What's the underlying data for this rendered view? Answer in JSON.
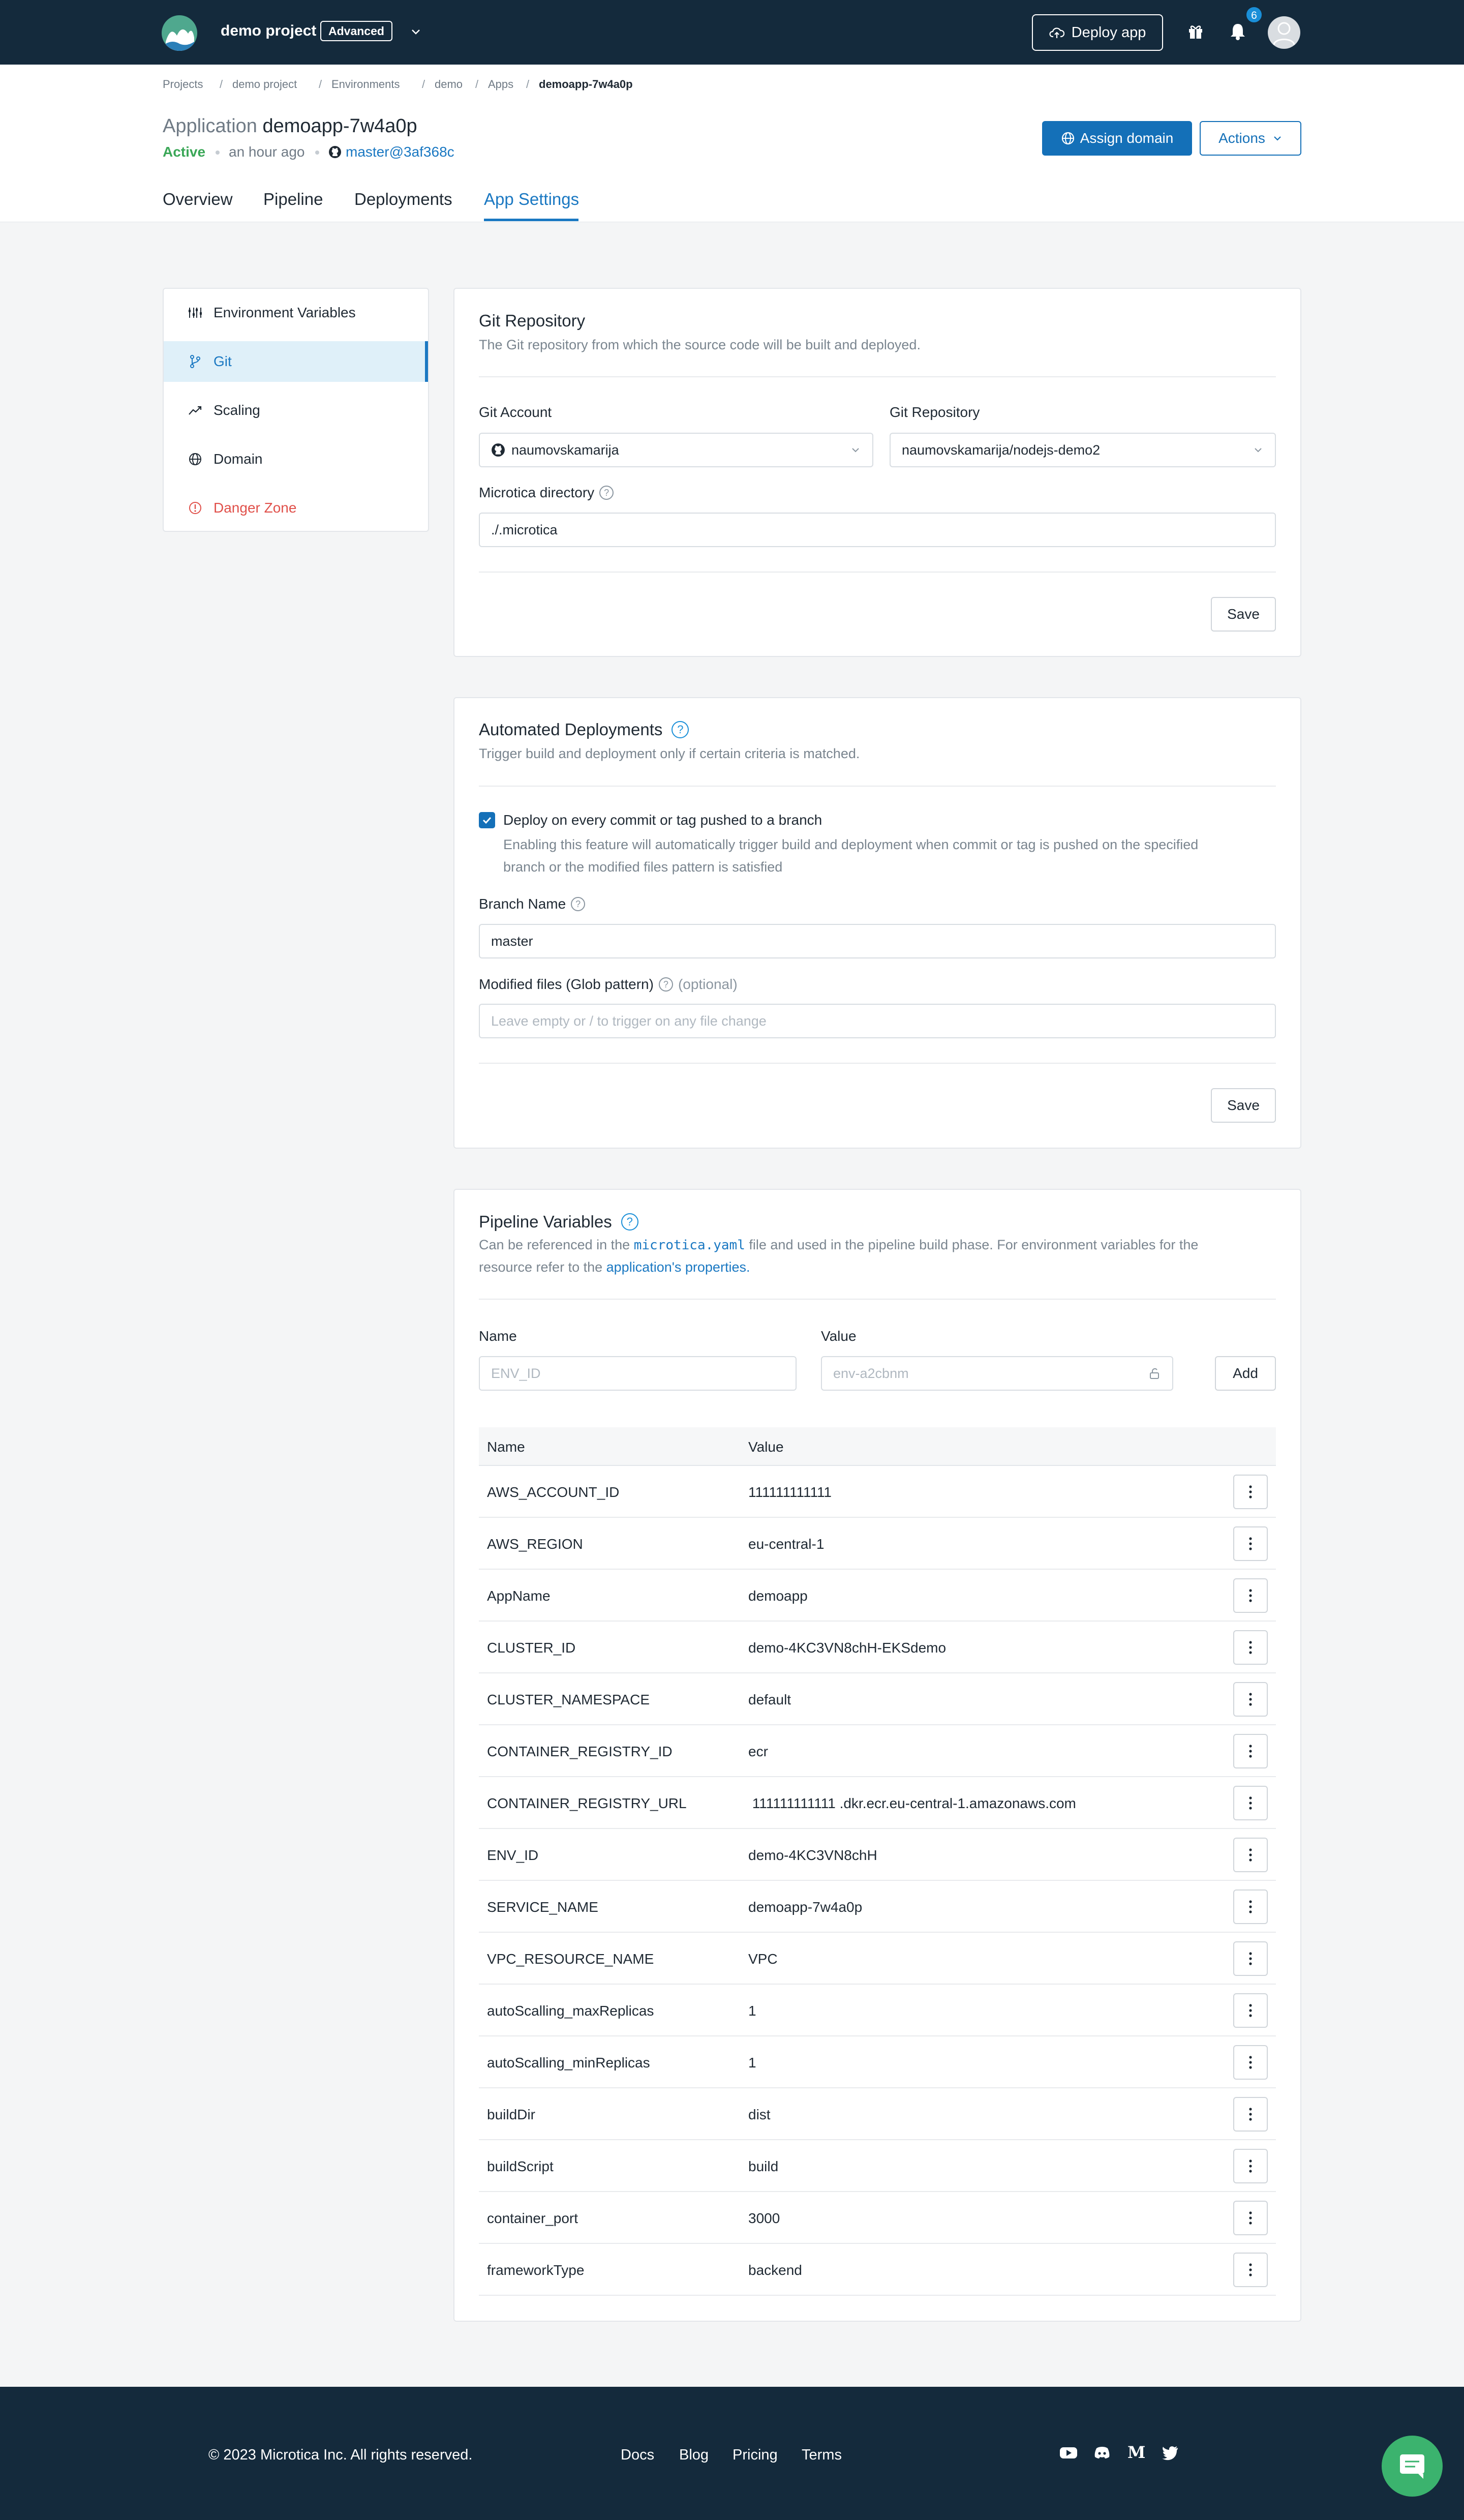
{
  "topbar": {
    "project_name": "demo project",
    "plan_badge": "Advanced",
    "deploy_label": "Deploy app",
    "notification_count": "6"
  },
  "breadcrumb": [
    "Projects",
    "demo project",
    "Environments",
    "demo",
    "Apps",
    "demoapp-7w4a0p"
  ],
  "app": {
    "title_prefix": "Application",
    "name": "demoapp-7w4a0p",
    "status": "Active",
    "updated": "an hour ago",
    "branch_commit": "master@3af368c"
  },
  "header_buttons": {
    "assign_domain": "Assign domain",
    "actions": "Actions"
  },
  "tabs": [
    "Overview",
    "Pipeline",
    "Deployments",
    "App Settings"
  ],
  "active_tab": "App Settings",
  "sidebar": {
    "items": [
      {
        "label": "Environment Variables",
        "icon": "sliders-icon"
      },
      {
        "label": "Git",
        "icon": "git-branch-icon"
      },
      {
        "label": "Scaling",
        "icon": "trend-icon"
      },
      {
        "label": "Domain",
        "icon": "globe-icon"
      },
      {
        "label": "Danger Zone",
        "icon": "alert-circle-icon"
      }
    ],
    "active": "Git"
  },
  "git": {
    "title": "Git Repository",
    "subtitle": "The Git repository from which the source code will be built and deployed.",
    "account_label": "Git Account",
    "account_value": "naumovskamarija",
    "repo_label": "Git Repository",
    "repo_value": "naumovskamarija/nodejs-demo2",
    "dir_label": "Microtica directory",
    "dir_value": "./.microtica",
    "save": "Save"
  },
  "auto": {
    "title": "Automated Deployments",
    "subtitle": "Trigger build and deployment only if certain criteria is matched.",
    "checkbox_label": "Deploy on every commit or tag pushed to a branch",
    "checkbox_checked": true,
    "desc_line1": "Enabling this feature will automatically trigger build and deployment when commit or tag is pushed on the specified",
    "desc_line2": "branch or the modified files pattern is satisfied",
    "branch_label": "Branch Name",
    "branch_value": "master",
    "glob_label": "Modified files (Glob pattern)",
    "glob_optional": "(optional)",
    "glob_placeholder": "Leave empty or / to trigger on any file change",
    "save": "Save"
  },
  "pipeline": {
    "title": "Pipeline Variables",
    "sub_part1": "Can be referenced in the",
    "sub_code": "microtica.yaml",
    "sub_part2": "file and used in the pipeline build phase. For environment variables for the",
    "sub_part3": "resource refer to the",
    "sub_link": "application's properties.",
    "name_label": "Name",
    "value_label": "Value",
    "name_placeholder": "ENV_ID",
    "value_placeholder": "env-a2cbnm",
    "add": "Add",
    "col_name": "Name",
    "col_value": "Value",
    "rows": [
      {
        "name": "AWS_ACCOUNT_ID",
        "value": "111111111111"
      },
      {
        "name": "AWS_REGION",
        "value": "eu-central-1"
      },
      {
        "name": "AppName",
        "value": "demoapp"
      },
      {
        "name": "CLUSTER_ID",
        "value": "demo-4KC3VN8chH-EKSdemo"
      },
      {
        "name": "CLUSTER_NAMESPACE",
        "value": "default"
      },
      {
        "name": "CONTAINER_REGISTRY_ID",
        "value": "ecr"
      },
      {
        "name": "CONTAINER_REGISTRY_URL",
        "value": " 111111111111 .dkr.ecr.eu-central-1.amazonaws.com"
      },
      {
        "name": "ENV_ID",
        "value": "demo-4KC3VN8chH"
      },
      {
        "name": "SERVICE_NAME",
        "value": "demoapp-7w4a0p"
      },
      {
        "name": "VPC_RESOURCE_NAME",
        "value": "VPC"
      },
      {
        "name": "autoScalling_maxReplicas",
        "value": "1"
      },
      {
        "name": "autoScalling_minReplicas",
        "value": "1"
      },
      {
        "name": "buildDir",
        "value": "dist"
      },
      {
        "name": "buildScript",
        "value": "build"
      },
      {
        "name": "container_port",
        "value": "3000"
      },
      {
        "name": "frameworkType",
        "value": "backend"
      }
    ]
  },
  "footer": {
    "copyright": "© 2023 Microtica Inc. All rights reserved.",
    "links": [
      "Docs",
      "Blog",
      "Pricing",
      "Terms"
    ],
    "social": [
      "youtube-icon",
      "discord-icon",
      "medium-icon",
      "twitter-icon"
    ]
  },
  "colors": {
    "navy": "#142a3c",
    "accent": "#1470b8",
    "active_green": "#3aa757",
    "danger": "#e0504a",
    "chat": "#3bb36e"
  }
}
